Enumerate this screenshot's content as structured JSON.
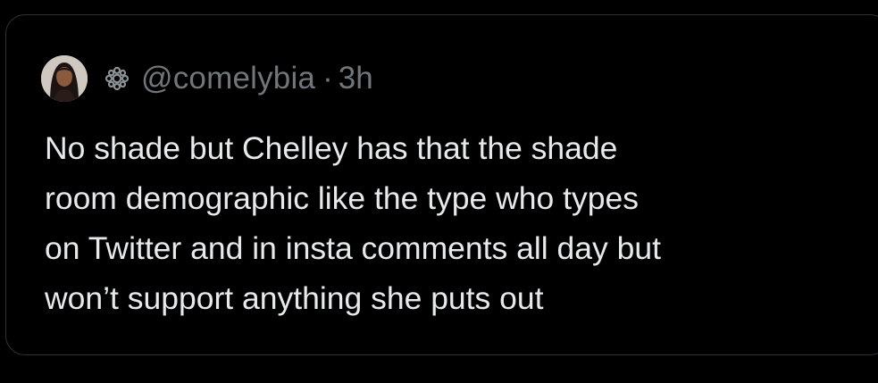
{
  "colors": {
    "background": "#000000",
    "border": "#2f3336",
    "text_primary": "#e7e9ea",
    "text_secondary": "#71767b"
  },
  "tweet": {
    "avatar_icon": "profile-photo",
    "badge_icon": "verified-flower-badge",
    "handle": "@comelybia",
    "separator": "·",
    "timestamp": "3h",
    "lines": [
      "No shade but Chelley has that the shade",
      "room demographic like the type who types",
      "on Twitter and in insta comments all day but",
      "won’t support anything she puts out"
    ]
  }
}
